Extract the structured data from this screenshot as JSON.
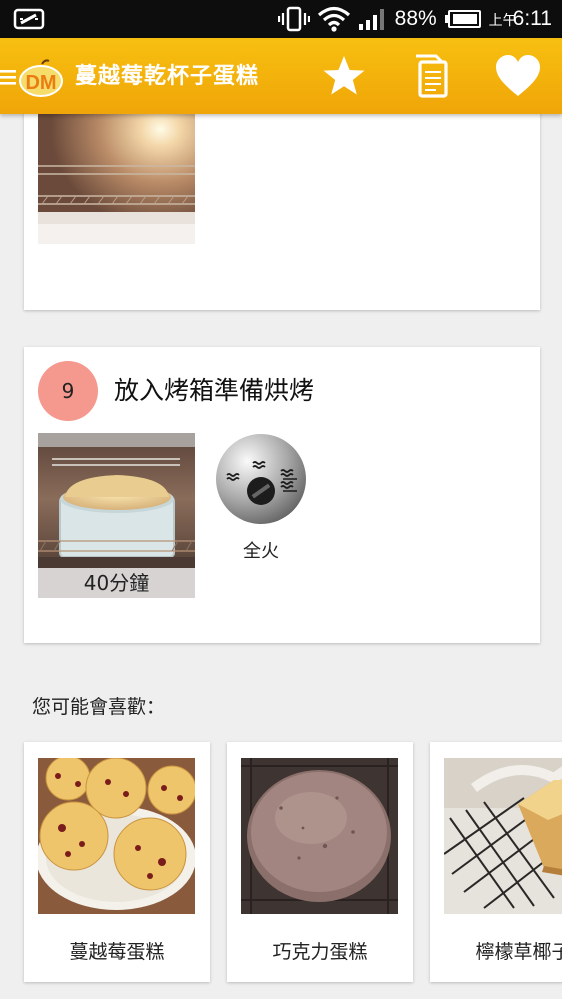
{
  "status_bar": {
    "battery_percent": "88%",
    "time_prefix": "上午",
    "time": "6:11",
    "icons": [
      "tablet-icon",
      "vibrate-icon",
      "wifi-icon",
      "signal-icon",
      "battery-icon"
    ]
  },
  "toolbar": {
    "logo_text": "DM",
    "title": "蔓越莓乾杯子蛋糕",
    "icons": [
      "menu-icon",
      "star-icon",
      "copy-icon",
      "heart-icon"
    ]
  },
  "steps": [
    {
      "number": "",
      "title": "",
      "photo_icon": "oven-preheat-photo"
    },
    {
      "number": "9",
      "title": "放入烤箱準備烘烤",
      "photo_icon": "cake-in-oven-photo",
      "duration": "40分鐘",
      "heat_icon": "full-heat-icon",
      "heat_label": "全火"
    }
  ],
  "recommendations": {
    "heading": "您可能會喜歡：",
    "items": [
      {
        "name": "蔓越莓蛋糕",
        "icon": "cranberry-cupcakes-photo"
      },
      {
        "name": "巧克力蛋糕",
        "icon": "chocolate-cake-photo"
      },
      {
        "name": "檸檬草椰子",
        "icon": "lemongrass-coconut-cake-photo"
      }
    ]
  },
  "colors": {
    "toolbar": "#f5b30c",
    "status_bar": "#0d0d0d",
    "step_circle": "#f5998e",
    "background": "#efefef"
  }
}
